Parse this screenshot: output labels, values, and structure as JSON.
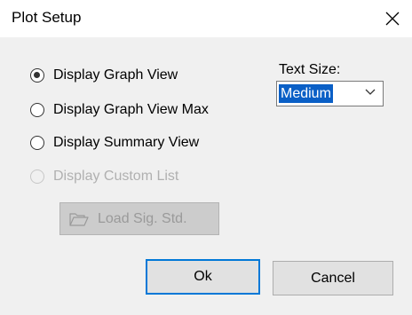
{
  "window": {
    "title": "Plot Setup"
  },
  "display_options": [
    {
      "label": "Display Graph View",
      "checked": true,
      "enabled": true
    },
    {
      "label": "Display Graph View Max",
      "checked": false,
      "enabled": true
    },
    {
      "label": "Display Summary View",
      "checked": false,
      "enabled": true
    },
    {
      "label": "Display Custom List",
      "checked": false,
      "enabled": false
    }
  ],
  "text_size": {
    "label": "Text Size:",
    "selected": "Medium"
  },
  "buttons": {
    "load_sig_std": "Load Sig. Std.",
    "ok": "Ok",
    "cancel": "Cancel"
  },
  "colors": {
    "accent": "#0078d7",
    "selection": "#0a5fc6",
    "window_bg": "#f0f0f0",
    "disabled_text": "#b0b0b0"
  },
  "icons": {
    "close": "close-icon",
    "dropdown": "chevron-down-icon",
    "folder": "folder-icon"
  }
}
